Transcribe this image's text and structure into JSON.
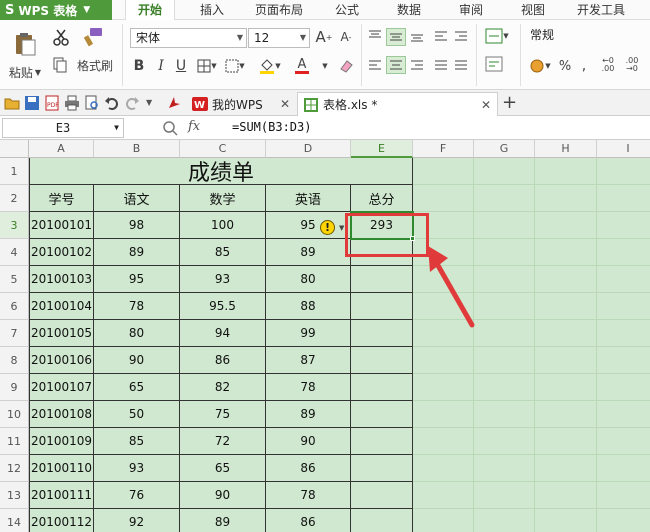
{
  "app": {
    "name": "WPS 表格",
    "logo": "S"
  },
  "menu": {
    "tabs": [
      "开始",
      "插入",
      "页面布局",
      "公式",
      "数据",
      "审阅",
      "视图",
      "开发工具"
    ],
    "active": "开始"
  },
  "ribbon": {
    "paste_label": "粘贴",
    "format_painter_label": "格式刷",
    "font_name": "宋体",
    "font_size": "12",
    "bold": "B",
    "italic": "I",
    "underline": "U",
    "number_format": "常规",
    "percent": "%",
    "thousand_sep": ","
  },
  "doc_tabs": [
    {
      "label": "我的WPS",
      "active": false
    },
    {
      "label": "表格.xls *",
      "active": true
    }
  ],
  "formula_bar": {
    "name_box": "E3",
    "fx": "fx",
    "formula": "=SUM(B3:D3)"
  },
  "grid": {
    "columns": [
      "A",
      "B",
      "C",
      "D",
      "E",
      "F",
      "G",
      "H",
      "I"
    ],
    "rows": [
      "1",
      "2",
      "3",
      "4",
      "5",
      "6",
      "7",
      "8",
      "9",
      "10",
      "11",
      "12",
      "13",
      "14"
    ],
    "selected_cell": "E3",
    "title": "成绩单",
    "headers": [
      "学号",
      "语文",
      "数学",
      "英语",
      "总分"
    ],
    "data": [
      [
        "20100101",
        "98",
        "100",
        "95",
        "293"
      ],
      [
        "20100102",
        "89",
        "85",
        "89",
        ""
      ],
      [
        "20100103",
        "95",
        "93",
        "80",
        ""
      ],
      [
        "20100104",
        "78",
        "95.5",
        "88",
        ""
      ],
      [
        "20100105",
        "80",
        "94",
        "99",
        ""
      ],
      [
        "20100106",
        "90",
        "86",
        "87",
        ""
      ],
      [
        "20100107",
        "65",
        "82",
        "78",
        ""
      ],
      [
        "20100108",
        "50",
        "75",
        "89",
        ""
      ],
      [
        "20100109",
        "85",
        "72",
        "90",
        ""
      ],
      [
        "20100110",
        "93",
        "65",
        "86",
        ""
      ],
      [
        "20100111",
        "76",
        "90",
        "78",
        ""
      ],
      [
        "20100112",
        "92",
        "89",
        "86",
        ""
      ]
    ]
  },
  "colors": {
    "accent": "#4f9a3b",
    "grid_bg": "#cfe8cf",
    "highlight": "#e03a3a"
  }
}
